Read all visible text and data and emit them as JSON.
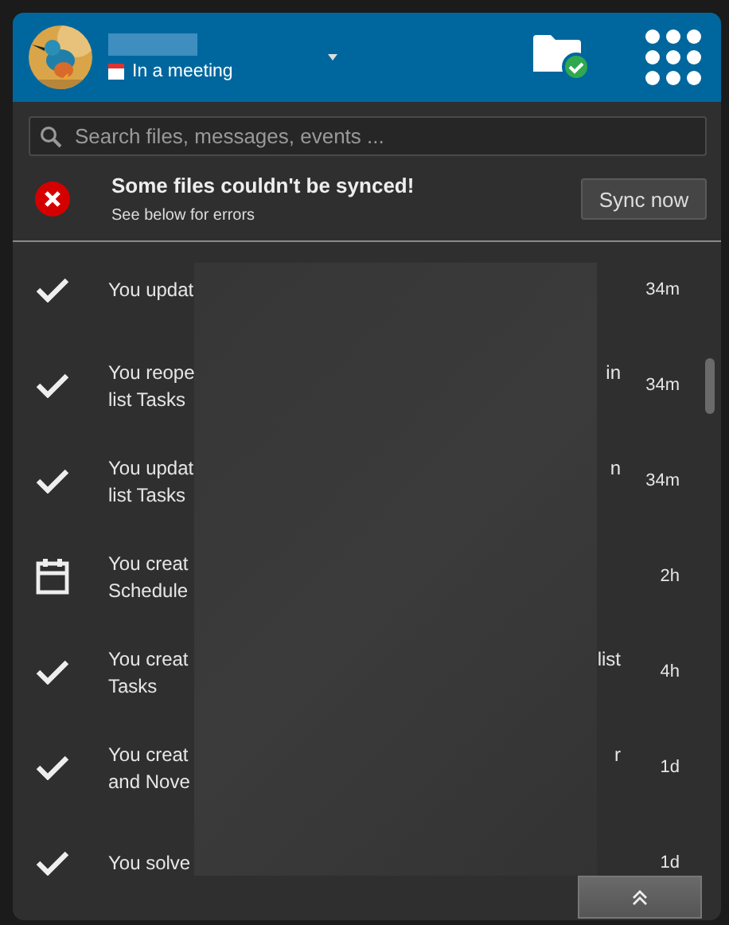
{
  "header": {
    "status": {
      "text": "In a meeting"
    }
  },
  "search": {
    "placeholder": "Search files, messages, events ..."
  },
  "sync_error": {
    "title": "Some files couldn't be synced!",
    "subtitle": "See below for errors",
    "button": "Sync now"
  },
  "activities": [
    {
      "kind": "task",
      "lines": [
        {
          "start": "You updat"
        }
      ],
      "time": "34m"
    },
    {
      "kind": "task",
      "lines": [
        {
          "start": "You reope",
          "end": "in"
        },
        {
          "start": "list Tasks"
        }
      ],
      "time": "34m"
    },
    {
      "kind": "task",
      "lines": [
        {
          "start": "You updat",
          "end": "n"
        },
        {
          "start": "list Tasks"
        }
      ],
      "time": "34m"
    },
    {
      "kind": "event",
      "lines": [
        {
          "start": "You creat"
        },
        {
          "start": "Schedule"
        }
      ],
      "time": "2h"
    },
    {
      "kind": "task",
      "lines": [
        {
          "start": "You creat",
          "end": "list"
        },
        {
          "start": "Tasks"
        }
      ],
      "time": "4h"
    },
    {
      "kind": "task",
      "lines": [
        {
          "start": "You creat",
          "end": "r"
        },
        {
          "start": "and Nove"
        }
      ],
      "time": "1d"
    },
    {
      "kind": "task",
      "lines": [
        {
          "start": "You solve"
        }
      ],
      "time": "1d"
    }
  ]
}
